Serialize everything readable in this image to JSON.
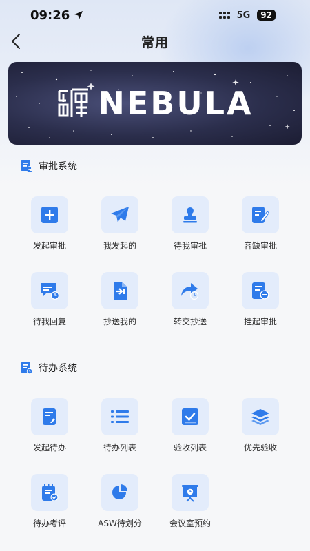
{
  "status": {
    "time": "09:26",
    "network": "5G",
    "battery": "92"
  },
  "nav": {
    "title": "常用"
  },
  "banner": {
    "brand": "NEBULA"
  },
  "approval": {
    "title": "审批系统",
    "items": [
      {
        "label": "发起审批",
        "icon": "plus-icon"
      },
      {
        "label": "我发起的",
        "icon": "paper-plane-icon"
      },
      {
        "label": "待我审批",
        "icon": "stamp-icon"
      },
      {
        "label": "容缺审批",
        "icon": "edit-document-icon"
      },
      {
        "label": "待我回复",
        "icon": "message-clock-icon"
      },
      {
        "label": "抄送我的",
        "icon": "document-import-icon"
      },
      {
        "label": "转交抄送",
        "icon": "forward-clock-icon"
      },
      {
        "label": "挂起审批",
        "icon": "document-minus-icon"
      }
    ]
  },
  "todo": {
    "title": "待办系统",
    "items": [
      {
        "label": "发起待办",
        "icon": "document-pin-icon"
      },
      {
        "label": "待办列表",
        "icon": "list-icon"
      },
      {
        "label": "验收列表",
        "icon": "checkbox-icon"
      },
      {
        "label": "优先验收",
        "icon": "layers-icon"
      },
      {
        "label": "待办考评",
        "icon": "notepad-check-icon"
      },
      {
        "label": "ASW待划分",
        "icon": "pie-chart-icon"
      },
      {
        "label": "会议室预约",
        "icon": "presentation-icon"
      }
    ]
  },
  "colors": {
    "accent": "#2f7bea",
    "tile_bg": "#e3ecfb"
  }
}
